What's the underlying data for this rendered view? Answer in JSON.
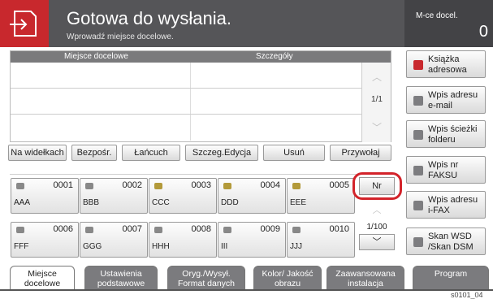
{
  "header": {
    "title": "Gotowa do wysłania.",
    "subtitle": "Wprowadź miejsce docelowe.",
    "mce_label": "M-ce docel.",
    "mce_count": "0"
  },
  "dest_table": {
    "col_destination": "Miejsce docelowe",
    "col_details": "Szczegóły",
    "page": "1/1"
  },
  "side_buttons": [
    {
      "label": "Książka adresowa"
    },
    {
      "label": "Wpis adresu e-mail"
    },
    {
      "label": "Wpis ścieżki folderu"
    },
    {
      "label": "Wpis nr FAKSU"
    },
    {
      "label": "Wpis adresu i-FAX"
    },
    {
      "label": "Skan WSD /Skan DSM"
    }
  ],
  "actions": [
    {
      "label": "Na widełkach"
    },
    {
      "label": "Bezpośr."
    },
    {
      "label": "Łańcuch"
    },
    {
      "label": "Szczeg.Edycja"
    },
    {
      "label": "Usuń"
    },
    {
      "label": "Przywołaj"
    }
  ],
  "one_touch": [
    {
      "num": "0001",
      "name": "AAA"
    },
    {
      "num": "0002",
      "name": "BBB"
    },
    {
      "num": "0003",
      "name": "CCC"
    },
    {
      "num": "0004",
      "name": "DDD"
    },
    {
      "num": "0005",
      "name": "EEE"
    },
    {
      "num": "0006",
      "name": "FFF"
    },
    {
      "num": "0007",
      "name": "GGG"
    },
    {
      "num": "0008",
      "name": "HHH"
    },
    {
      "num": "0009",
      "name": "III"
    },
    {
      "num": "0010",
      "name": "JJJ"
    }
  ],
  "one_touch_nav": {
    "nr_label": "Nr",
    "page": "1/100"
  },
  "tabs": [
    {
      "label": "Miejsce docelowe"
    },
    {
      "label": "Ustawienia podstawowe"
    },
    {
      "label": "Oryg./Wysył. Format danych"
    },
    {
      "label": "Kolor/ Jakość obrazu"
    },
    {
      "label": "Zaawansowana instalacja"
    },
    {
      "label": "Program"
    }
  ],
  "footer_id": "s0101_04",
  "colors": {
    "header_bg": "#555558",
    "accent_red": "#c8282d",
    "tab_bg": "#7b7b7e"
  }
}
